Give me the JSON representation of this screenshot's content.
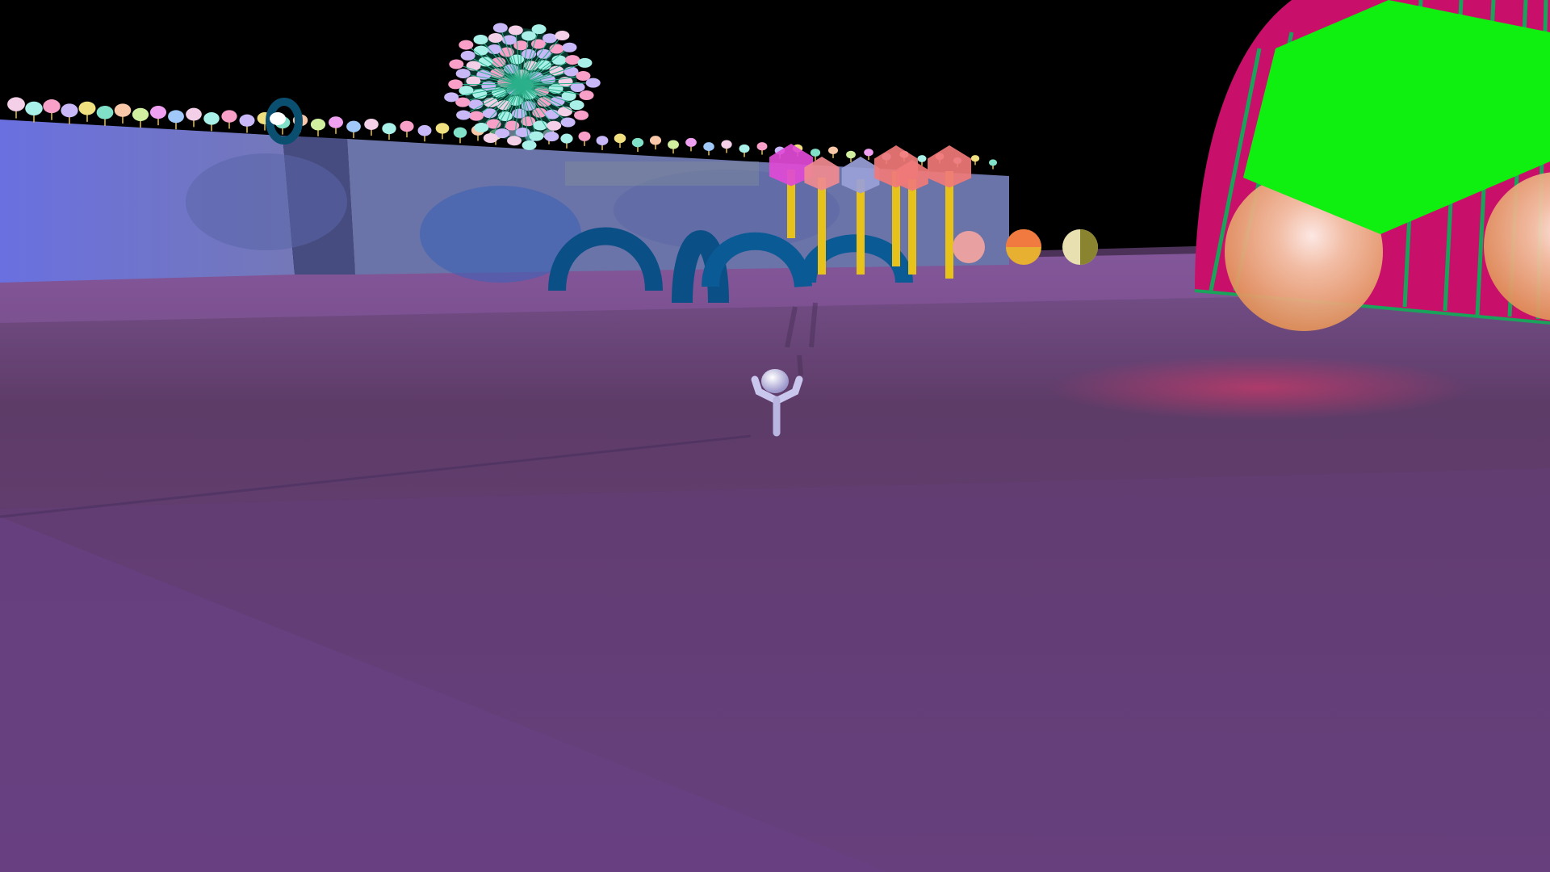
{
  "scene": {
    "type": "3d-game-viewport",
    "hud": [],
    "colors": {
      "sky": "#000000",
      "ground": "#664074",
      "ground_far": "#7a5694",
      "wall": "#6a74c8",
      "wall_side": "#5a5e9a",
      "arches": "#0a5a96",
      "dome": "#d6106e",
      "dome_stripes": "#1aa35a",
      "hexagon": "#10f010",
      "character": "#c9c7ee",
      "pole": "#e6c21a",
      "gem_pink": "#e04ad6",
      "gem_coral": "#f07a78"
    },
    "objects": [
      {
        "name": "player-character",
        "pose": "arms-raised"
      },
      {
        "name": "dandelion-sphere-tree"
      },
      {
        "name": "blue-arches",
        "count": 4
      },
      {
        "name": "gem-topped-poles",
        "count": 6
      },
      {
        "name": "striped-dome"
      },
      {
        "name": "green-hexagon"
      },
      {
        "name": "peach-spheres",
        "count": 2
      },
      {
        "name": "small-spheres-row",
        "count": 3
      },
      {
        "name": "lollipop-flowers-row"
      },
      {
        "name": "torus-ring"
      }
    ]
  }
}
